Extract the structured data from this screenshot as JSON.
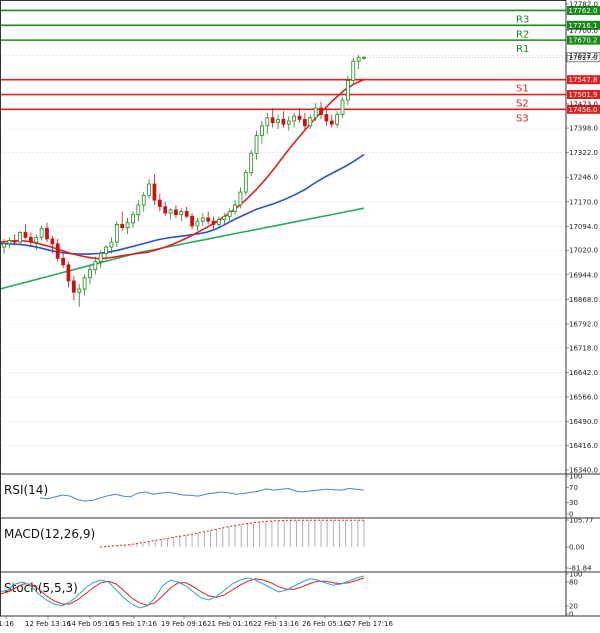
{
  "colors": {
    "resistance": "#1a8a1a",
    "support": "#e02020",
    "bull_candle": "#1a8a1a",
    "bear_candle": "#cc1111",
    "ma_fast": "#e02020",
    "ma_mid": "#2a4fd0",
    "ma_slow": "#2aa860",
    "rsi_line": "#4a7fe0",
    "macd_hist": "#b0b0b0",
    "macd_signal": "#e02020",
    "stoch_main": "#2aa8c8",
    "stoch_signal": "#e02020",
    "grid": "#dcdcdc"
  },
  "chart_data": {
    "type": "candlestick",
    "price_axis": {
      "ylim": [
        16340.0,
        17782.0
      ],
      "ticks": [
        "17782.0",
        "17700.0",
        "17622.0",
        "17473.0",
        "17398.0",
        "17322.0",
        "17246.0",
        "17170.0",
        "17094.0",
        "17020.0",
        "16944.0",
        "16868.0",
        "16792.0",
        "16718.0",
        "16642.0",
        "16566.0",
        "16490.0",
        "16416.0",
        "16340.0"
      ],
      "current": 17617.0,
      "current_label": "17617.0"
    },
    "levels": [
      {
        "name": "R3",
        "value": 17762.0,
        "label": "17762.0",
        "kind": "resistance"
      },
      {
        "name": "R2",
        "value": 17716.1,
        "label": "17716.1",
        "kind": "resistance"
      },
      {
        "name": "R1",
        "value": 17670.2,
        "label": "17670.2",
        "kind": "resistance"
      },
      {
        "name": "S1",
        "value": 17547.8,
        "label": "17547.8",
        "kind": "support"
      },
      {
        "name": "S2",
        "value": 17501.9,
        "label": "17501.9",
        "kind": "support"
      },
      {
        "name": "S3",
        "value": 17456.0,
        "label": "17456.0",
        "kind": "support"
      }
    ],
    "x_labels": [
      "1:16",
      "12 Feb 13:16",
      "14 Feb 05:16",
      "15 Feb 17:16",
      "19 Feb 09:16",
      "21 Feb 01:16",
      "22 Feb 13:16",
      "26 Feb 05:16",
      "27 Feb 17:16"
    ],
    "candles": [
      [
        17030,
        17055,
        17010,
        17040
      ],
      [
        17040,
        17060,
        17025,
        17050
      ],
      [
        17050,
        17070,
        17035,
        17045
      ],
      [
        17045,
        17080,
        17040,
        17075
      ],
      [
        17075,
        17100,
        17055,
        17060
      ],
      [
        17060,
        17075,
        17030,
        17045
      ],
      [
        17045,
        17070,
        17020,
        17060
      ],
      [
        17060,
        17095,
        17050,
        17088
      ],
      [
        17088,
        17105,
        17045,
        17055
      ],
      [
        17055,
        17065,
        17010,
        17040
      ],
      [
        17040,
        17055,
        16985,
        16995
      ],
      [
        16995,
        17010,
        16965,
        16975
      ],
      [
        16975,
        16985,
        16905,
        16925
      ],
      [
        16925,
        16940,
        16865,
        16890
      ],
      [
        16890,
        16915,
        16845,
        16900
      ],
      [
        16900,
        16945,
        16880,
        16935
      ],
      [
        16935,
        16975,
        16915,
        16960
      ],
      [
        16960,
        17000,
        16945,
        16985
      ],
      [
        16985,
        17020,
        16965,
        17010
      ],
      [
        17010,
        17035,
        16990,
        17030
      ],
      [
        17030,
        17060,
        17010,
        17045
      ],
      [
        17045,
        17110,
        17030,
        17100
      ],
      [
        17100,
        17140,
        17080,
        17090
      ],
      [
        17090,
        17120,
        17070,
        17105
      ],
      [
        17105,
        17140,
        17090,
        17130
      ],
      [
        17130,
        17175,
        17110,
        17160
      ],
      [
        17160,
        17200,
        17140,
        17190
      ],
      [
        17190,
        17240,
        17180,
        17225
      ],
      [
        17225,
        17255,
        17160,
        17175
      ],
      [
        17175,
        17195,
        17140,
        17155
      ],
      [
        17155,
        17170,
        17125,
        17135
      ],
      [
        17135,
        17150,
        17115,
        17145
      ],
      [
        17145,
        17160,
        17120,
        17130
      ],
      [
        17130,
        17150,
        17110,
        17140
      ],
      [
        17140,
        17155,
        17120,
        17125
      ],
      [
        17125,
        17135,
        17085,
        17095
      ],
      [
        17095,
        17120,
        17080,
        17110
      ],
      [
        17110,
        17135,
        17095,
        17120
      ],
      [
        17120,
        17140,
        17100,
        17110
      ],
      [
        17110,
        17125,
        17085,
        17100
      ],
      [
        17100,
        17125,
        17090,
        17115
      ],
      [
        17115,
        17135,
        17100,
        17125
      ],
      [
        17125,
        17150,
        17110,
        17140
      ],
      [
        17140,
        17175,
        17130,
        17160
      ],
      [
        17160,
        17215,
        17150,
        17200
      ],
      [
        17200,
        17270,
        17190,
        17260
      ],
      [
        17260,
        17330,
        17250,
        17320
      ],
      [
        17320,
        17390,
        17300,
        17375
      ],
      [
        17375,
        17420,
        17350,
        17405
      ],
      [
        17405,
        17445,
        17380,
        17430
      ],
      [
        17430,
        17460,
        17400,
        17415
      ],
      [
        17415,
        17440,
        17395,
        17425
      ],
      [
        17425,
        17450,
        17400,
        17410
      ],
      [
        17410,
        17435,
        17390,
        17420
      ],
      [
        17420,
        17445,
        17400,
        17435
      ],
      [
        17435,
        17460,
        17415,
        17425
      ],
      [
        17425,
        17445,
        17395,
        17405
      ],
      [
        17405,
        17440,
        17395,
        17430
      ],
      [
        17430,
        17475,
        17420,
        17460
      ],
      [
        17460,
        17480,
        17425,
        17440
      ],
      [
        17440,
        17455,
        17405,
        17420
      ],
      [
        17420,
        17440,
        17400,
        17410
      ],
      [
        17410,
        17450,
        17400,
        17440
      ],
      [
        17440,
        17495,
        17430,
        17485
      ],
      [
        17485,
        17560,
        17470,
        17545
      ],
      [
        17545,
        17615,
        17530,
        17605
      ],
      [
        17605,
        17625,
        17580,
        17617
      ],
      [
        17617,
        17622,
        17610,
        17617
      ]
    ],
    "ma_fast": [
      17045,
      17048,
      17050,
      17047,
      17040,
      17032,
      17022,
      17012,
      17004,
      16998,
      16994,
      16996,
      17001,
      17006,
      17010,
      17014,
      17022,
      17032,
      17044,
      17058,
      17074,
      17090,
      17108,
      17128,
      17150,
      17176,
      17206,
      17240,
      17278,
      17318,
      17356,
      17392,
      17426,
      17458,
      17488,
      17515,
      17535,
      17548
    ],
    "ma_mid": [
      17040,
      17040,
      17038,
      17034,
      17028,
      17020,
      17014,
      17010,
      17008,
      17008,
      17010,
      17014,
      17020,
      17028,
      17036,
      17044,
      17052,
      17058,
      17062,
      17066,
      17070,
      17076,
      17086,
      17102,
      17118,
      17132,
      17146,
      17156,
      17166,
      17178,
      17192,
      17208,
      17228,
      17246,
      17262,
      17278,
      17296,
      17316
    ],
    "ma_slow": [
      16900,
      16908,
      16916,
      16924,
      16932,
      16940,
      16948,
      16956,
      16964,
      16972,
      16980,
      16988,
      16996,
      17004,
      17012,
      17018,
      17024,
      17030,
      17036,
      17042,
      17048,
      17054,
      17060,
      17066,
      17072,
      17078,
      17084,
      17090,
      17096,
      17102,
      17108,
      17114,
      17120,
      17126,
      17132,
      17138,
      17144,
      17150
    ],
    "rsi": {
      "label": "RSI(14)",
      "ticks": [
        "100",
        "70",
        "30",
        "0"
      ],
      "ylim": [
        0,
        100
      ],
      "values": [
        42,
        40,
        45,
        50,
        47,
        38,
        34,
        36,
        42,
        48,
        52,
        47,
        45,
        55,
        58,
        52,
        55,
        57,
        54,
        50,
        49,
        47,
        52,
        55,
        58,
        56,
        52,
        54,
        57,
        60,
        66,
        63,
        65,
        67,
        60,
        58,
        61,
        63,
        65,
        64,
        63,
        67,
        65,
        63
      ]
    },
    "macd": {
      "label": "MACD(12,26,9)",
      "ticks": [
        "105.77",
        "0.00",
        "-81.84"
      ],
      "ylim": [
        -81.84,
        105.77
      ],
      "histogram": [
        0,
        2,
        4,
        6,
        8,
        10,
        14,
        18,
        22,
        26,
        30,
        34,
        38,
        42,
        46,
        50,
        55,
        60,
        65,
        70,
        75,
        80,
        84,
        88,
        92,
        95,
        98,
        100,
        102,
        103,
        104,
        105,
        105,
        105,
        105,
        105,
        105,
        105,
        105,
        105,
        105,
        105,
        105,
        105
      ]
    },
    "stoch": {
      "label": "Stoch(5,5,3)",
      "ticks": [
        "100",
        "80",
        "20",
        "0"
      ],
      "ylim": [
        0,
        100
      ],
      "main": [
        55,
        60,
        75,
        80,
        70,
        50,
        35,
        25,
        20,
        30,
        45,
        65,
        78,
        85,
        80,
        60,
        40,
        25,
        15,
        20,
        40,
        70,
        85,
        80,
        70,
        55,
        40,
        35,
        45,
        60,
        75,
        85,
        90,
        85,
        75,
        65,
        55,
        60,
        70,
        80,
        88,
        85,
        78,
        72,
        75,
        82,
        90,
        95
      ],
      "signal": [
        50,
        55,
        65,
        75,
        75,
        62,
        45,
        33,
        25,
        25,
        35,
        50,
        65,
        78,
        82,
        75,
        58,
        40,
        28,
        22,
        28,
        45,
        65,
        78,
        78,
        68,
        55,
        45,
        42,
        48,
        60,
        72,
        82,
        88,
        85,
        78,
        68,
        62,
        62,
        68,
        76,
        82,
        82,
        78,
        76,
        78,
        84,
        90
      ]
    }
  }
}
